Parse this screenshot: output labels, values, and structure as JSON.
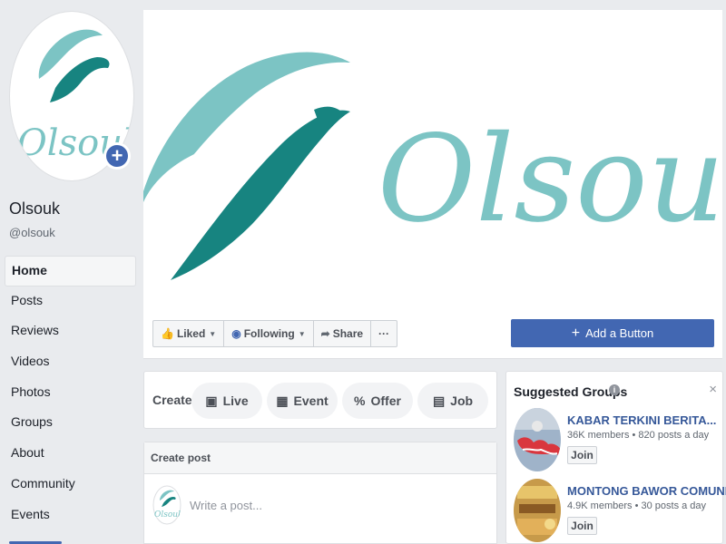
{
  "page": {
    "name": "Olsouk",
    "handle": "@olsouk",
    "avatar_icon": "olsouk-logo",
    "brand_colors": {
      "light_teal": "#7cc4c4",
      "dark_teal": "#178480"
    }
  },
  "nav": {
    "items": [
      "Home",
      "Posts",
      "Reviews",
      "Videos",
      "Photos",
      "Groups",
      "About",
      "Community",
      "Events"
    ],
    "active": "Home"
  },
  "actions": {
    "liked": "Liked",
    "following": "Following",
    "share": "Share",
    "more": "···",
    "add_button": "Add a Button"
  },
  "create": {
    "label": "Create",
    "items": [
      "Live",
      "Event",
      "Offer",
      "Job"
    ]
  },
  "post": {
    "header": "Create post",
    "placeholder": "Write a post..."
  },
  "suggested": {
    "title": "Suggested Groups",
    "close": "×",
    "groups": [
      {
        "name": "KABAR TERKINI BERITA...",
        "meta": "36K members • 820 posts a day",
        "join": "Join"
      },
      {
        "name": "MONTONG BAWOR COMUNITY",
        "meta": "4.9K members • 30 posts a day",
        "join": "Join"
      }
    ]
  }
}
